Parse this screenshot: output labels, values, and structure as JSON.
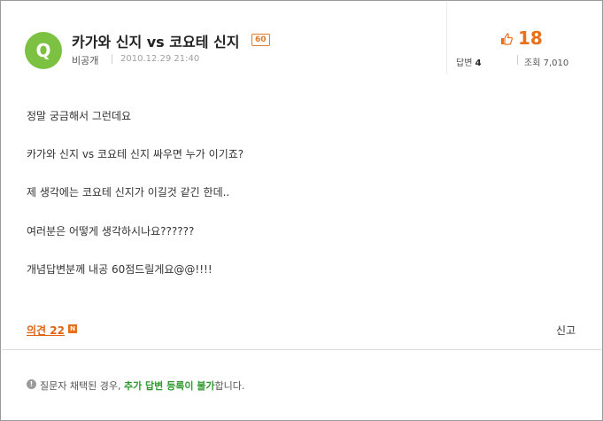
{
  "question": {
    "badge_letter": "Q",
    "title": "카가와 신지 vs 코요테 신지",
    "points": "60",
    "author": "비공개",
    "date": "2010.12.29 21:40"
  },
  "stats": {
    "thumb_icon": "thumb-up-icon",
    "recommend_count": "18",
    "answers_label": "답변",
    "answers_count": "4",
    "views_label": "조회",
    "views_count": "7,010"
  },
  "body": {
    "lines": [
      "정말 궁금해서 그런데요",
      "카가와 신지 vs 코요테 신지 싸우면 누가 이기죠?",
      "제 생각에는 코요테 신지가 이길것 같긴 한데..",
      "여러분은 어떻게 생각하시나요??????",
      "개념답변분께 내공 60점드릴게요@@!!!!"
    ]
  },
  "footer": {
    "opinion_label": "의견 22",
    "new_mark": "N",
    "report_label": "신고"
  },
  "notice": {
    "prefix": "질문자 채택된 경우, ",
    "highlight": "추가 답변 등록이 불가",
    "suffix": "합니다."
  },
  "colors": {
    "badge_green": "#7cc142",
    "accent_orange": "#e8701a",
    "notice_green": "#2e9a2e"
  }
}
